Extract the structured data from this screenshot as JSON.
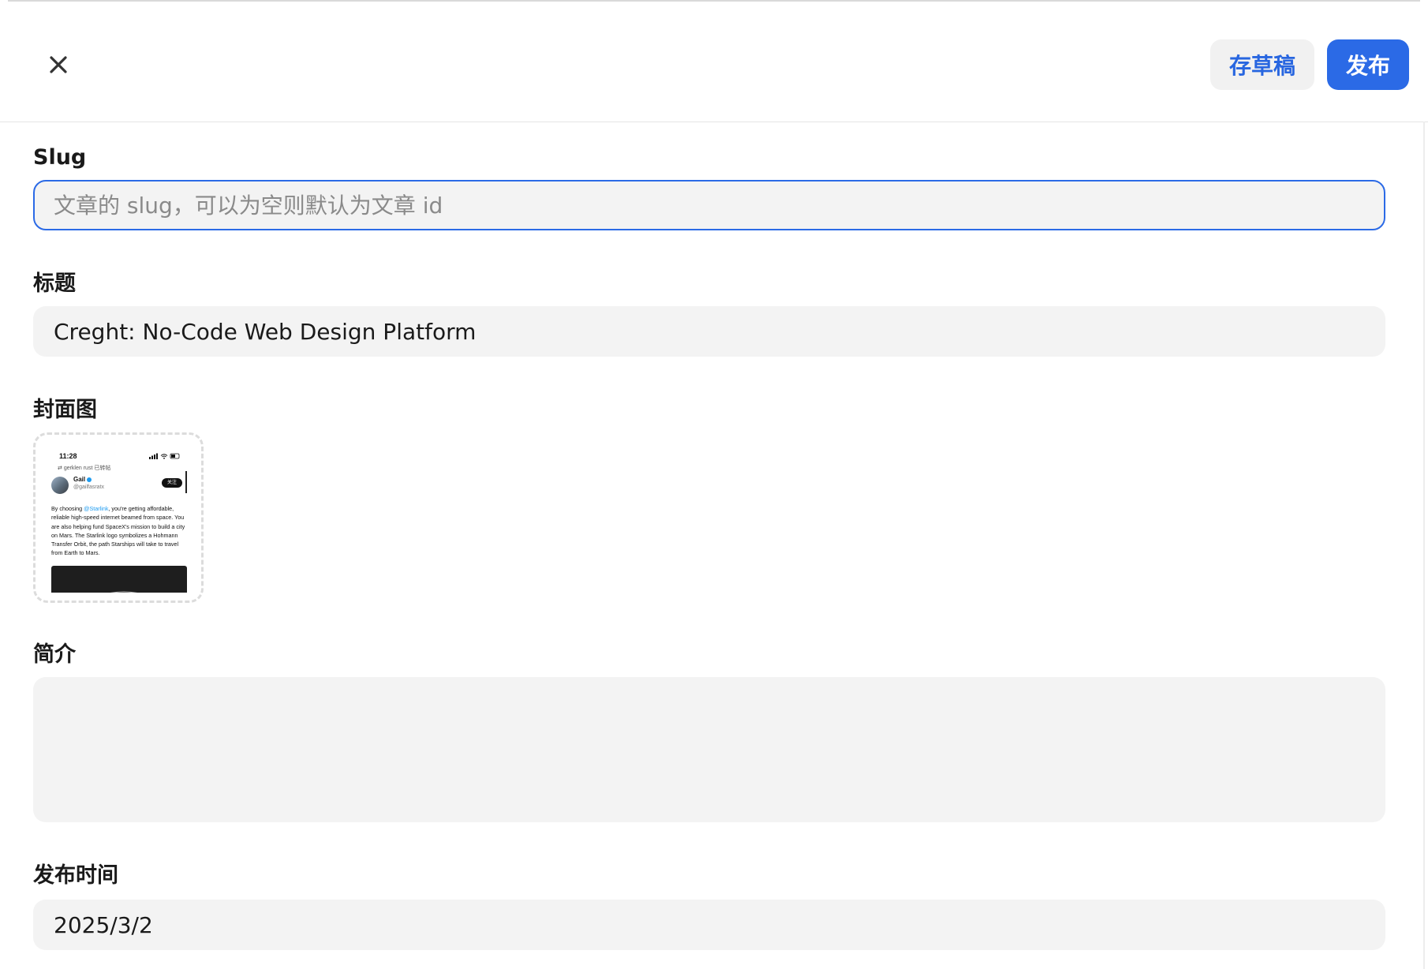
{
  "header": {
    "draft_label": "存草稿",
    "publish_label": "发布"
  },
  "form": {
    "slug": {
      "label": "Slug",
      "value": "",
      "placeholder": "文章的 slug，可以为空则默认为文章 id"
    },
    "title": {
      "label": "标题",
      "value": "Creght: No-Code Web Design Platform"
    },
    "cover": {
      "label": "封面图",
      "preview": {
        "time": "11:28",
        "repost_text": "gerklen rust 已转帖",
        "name": "Gail",
        "handle": "@gailfasratx",
        "follow_label": "关注",
        "body_before": "By choosing ",
        "mention": "@Starlink",
        "body_after": ", you're getting affordable, reliable high-speed internet beamed from space. You are also helping fund SpaceX's mission to build a city on Mars. The Starlink logo symbolizes a Hohmann Transfer Orbit, the path Starships will take to travel from Earth to Mars."
      }
    },
    "summary": {
      "label": "简介",
      "value": ""
    },
    "publish_time": {
      "label": "发布时间",
      "value": "2025/3/2"
    }
  },
  "colors": {
    "accent": "#2b6ae6",
    "field_bg": "#f3f3f3",
    "draft_bg": "#f1f1f1"
  },
  "icons": {
    "close": "close-icon"
  }
}
